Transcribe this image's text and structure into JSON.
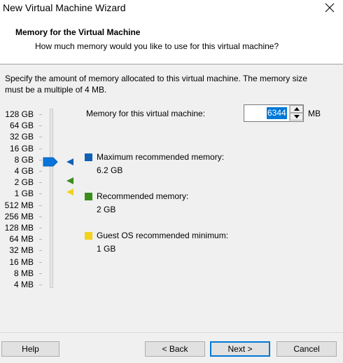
{
  "window": {
    "title": "New Virtual Machine Wizard"
  },
  "header": {
    "title": "Memory for the Virtual Machine",
    "subtitle": "How much memory would you like to use for this virtual machine?"
  },
  "description": "Specify the amount of memory allocated to this virtual machine. The memory size must be a multiple of 4 MB.",
  "scale_labels": [
    "128 GB",
    "64 GB",
    "32 GB",
    "16 GB",
    "8 GB",
    "4 GB",
    "2 GB",
    "1 GB",
    "512 MB",
    "256 MB",
    "128 MB",
    "64 MB",
    "32 MB",
    "16 MB",
    "8 MB",
    "4 MB"
  ],
  "memory": {
    "label": "Memory for this virtual machine:",
    "value": "6344",
    "unit": "MB"
  },
  "legend": {
    "max": {
      "label": "Maximum recommended memory:",
      "value": "6.2 GB",
      "color": "#1160b6"
    },
    "rec": {
      "label": "Recommended memory:",
      "value": "2 GB",
      "color": "#3a8d1c"
    },
    "min": {
      "label": "Guest OS recommended minimum:",
      "value": "1 GB",
      "color": "#f2d21b"
    }
  },
  "slider": {
    "thumb_color": "#0a74da"
  },
  "buttons": {
    "help": "Help",
    "back": "< Back",
    "next": "Next >",
    "cancel": "Cancel"
  }
}
